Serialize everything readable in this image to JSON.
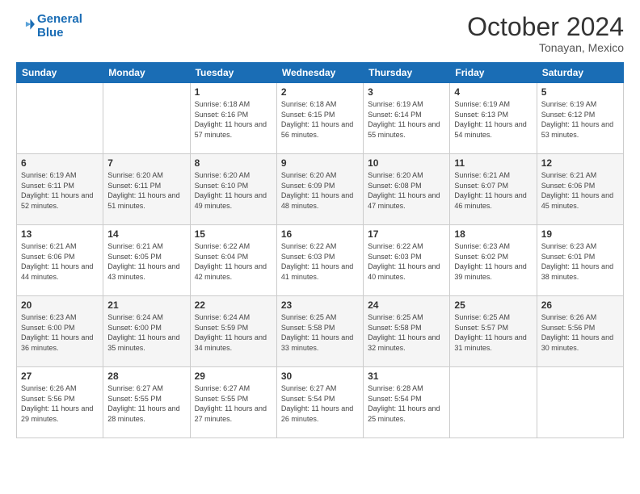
{
  "logo": {
    "line1": "General",
    "line2": "Blue"
  },
  "title": "October 2024",
  "subtitle": "Tonayan, Mexico",
  "days_header": [
    "Sunday",
    "Monday",
    "Tuesday",
    "Wednesday",
    "Thursday",
    "Friday",
    "Saturday"
  ],
  "weeks": [
    [
      {
        "day": "",
        "info": ""
      },
      {
        "day": "",
        "info": ""
      },
      {
        "day": "1",
        "info": "Sunrise: 6:18 AM\nSunset: 6:16 PM\nDaylight: 11 hours and 57 minutes."
      },
      {
        "day": "2",
        "info": "Sunrise: 6:18 AM\nSunset: 6:15 PM\nDaylight: 11 hours and 56 minutes."
      },
      {
        "day": "3",
        "info": "Sunrise: 6:19 AM\nSunset: 6:14 PM\nDaylight: 11 hours and 55 minutes."
      },
      {
        "day": "4",
        "info": "Sunrise: 6:19 AM\nSunset: 6:13 PM\nDaylight: 11 hours and 54 minutes."
      },
      {
        "day": "5",
        "info": "Sunrise: 6:19 AM\nSunset: 6:12 PM\nDaylight: 11 hours and 53 minutes."
      }
    ],
    [
      {
        "day": "6",
        "info": "Sunrise: 6:19 AM\nSunset: 6:11 PM\nDaylight: 11 hours and 52 minutes."
      },
      {
        "day": "7",
        "info": "Sunrise: 6:20 AM\nSunset: 6:11 PM\nDaylight: 11 hours and 51 minutes."
      },
      {
        "day": "8",
        "info": "Sunrise: 6:20 AM\nSunset: 6:10 PM\nDaylight: 11 hours and 49 minutes."
      },
      {
        "day": "9",
        "info": "Sunrise: 6:20 AM\nSunset: 6:09 PM\nDaylight: 11 hours and 48 minutes."
      },
      {
        "day": "10",
        "info": "Sunrise: 6:20 AM\nSunset: 6:08 PM\nDaylight: 11 hours and 47 minutes."
      },
      {
        "day": "11",
        "info": "Sunrise: 6:21 AM\nSunset: 6:07 PM\nDaylight: 11 hours and 46 minutes."
      },
      {
        "day": "12",
        "info": "Sunrise: 6:21 AM\nSunset: 6:06 PM\nDaylight: 11 hours and 45 minutes."
      }
    ],
    [
      {
        "day": "13",
        "info": "Sunrise: 6:21 AM\nSunset: 6:06 PM\nDaylight: 11 hours and 44 minutes."
      },
      {
        "day": "14",
        "info": "Sunrise: 6:21 AM\nSunset: 6:05 PM\nDaylight: 11 hours and 43 minutes."
      },
      {
        "day": "15",
        "info": "Sunrise: 6:22 AM\nSunset: 6:04 PM\nDaylight: 11 hours and 42 minutes."
      },
      {
        "day": "16",
        "info": "Sunrise: 6:22 AM\nSunset: 6:03 PM\nDaylight: 11 hours and 41 minutes."
      },
      {
        "day": "17",
        "info": "Sunrise: 6:22 AM\nSunset: 6:03 PM\nDaylight: 11 hours and 40 minutes."
      },
      {
        "day": "18",
        "info": "Sunrise: 6:23 AM\nSunset: 6:02 PM\nDaylight: 11 hours and 39 minutes."
      },
      {
        "day": "19",
        "info": "Sunrise: 6:23 AM\nSunset: 6:01 PM\nDaylight: 11 hours and 38 minutes."
      }
    ],
    [
      {
        "day": "20",
        "info": "Sunrise: 6:23 AM\nSunset: 6:00 PM\nDaylight: 11 hours and 36 minutes."
      },
      {
        "day": "21",
        "info": "Sunrise: 6:24 AM\nSunset: 6:00 PM\nDaylight: 11 hours and 35 minutes."
      },
      {
        "day": "22",
        "info": "Sunrise: 6:24 AM\nSunset: 5:59 PM\nDaylight: 11 hours and 34 minutes."
      },
      {
        "day": "23",
        "info": "Sunrise: 6:25 AM\nSunset: 5:58 PM\nDaylight: 11 hours and 33 minutes."
      },
      {
        "day": "24",
        "info": "Sunrise: 6:25 AM\nSunset: 5:58 PM\nDaylight: 11 hours and 32 minutes."
      },
      {
        "day": "25",
        "info": "Sunrise: 6:25 AM\nSunset: 5:57 PM\nDaylight: 11 hours and 31 minutes."
      },
      {
        "day": "26",
        "info": "Sunrise: 6:26 AM\nSunset: 5:56 PM\nDaylight: 11 hours and 30 minutes."
      }
    ],
    [
      {
        "day": "27",
        "info": "Sunrise: 6:26 AM\nSunset: 5:56 PM\nDaylight: 11 hours and 29 minutes."
      },
      {
        "day": "28",
        "info": "Sunrise: 6:27 AM\nSunset: 5:55 PM\nDaylight: 11 hours and 28 minutes."
      },
      {
        "day": "29",
        "info": "Sunrise: 6:27 AM\nSunset: 5:55 PM\nDaylight: 11 hours and 27 minutes."
      },
      {
        "day": "30",
        "info": "Sunrise: 6:27 AM\nSunset: 5:54 PM\nDaylight: 11 hours and 26 minutes."
      },
      {
        "day": "31",
        "info": "Sunrise: 6:28 AM\nSunset: 5:54 PM\nDaylight: 11 hours and 25 minutes."
      },
      {
        "day": "",
        "info": ""
      },
      {
        "day": "",
        "info": ""
      }
    ]
  ]
}
